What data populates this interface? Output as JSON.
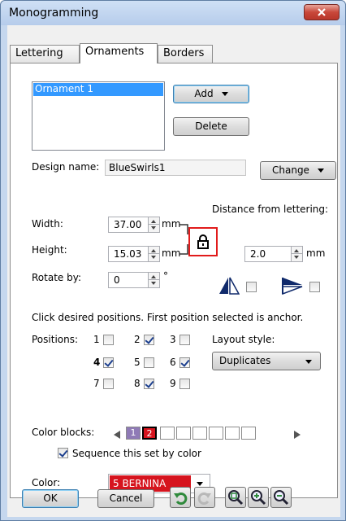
{
  "window": {
    "title": "Monogramming"
  },
  "tabs": [
    {
      "label": "Lettering",
      "active": false
    },
    {
      "label": "Ornaments",
      "active": true
    },
    {
      "label": "Borders",
      "active": false
    }
  ],
  "ornaments": {
    "list_items": [
      "Ornament 1"
    ],
    "add_label": "Add",
    "delete_label": "Delete",
    "design_name_label": "Design name:",
    "design_name_value": "BlueSwirls1",
    "change_label": "Change"
  },
  "size": {
    "distance_label": "Distance from lettering:",
    "width_label": "Width:",
    "width_value": "37.00",
    "height_label": "Height:",
    "height_value": "15.03",
    "unit_mm": "mm",
    "distance_value": "2.0",
    "rotate_label": "Rotate by:",
    "rotate_value": "0",
    "degree": "°"
  },
  "positions": {
    "instruction": "Click desired positions. First position selected is anchor.",
    "label": "Positions:",
    "items": [
      {
        "n": "1",
        "checked": false,
        "anchor": false
      },
      {
        "n": "2",
        "checked": true,
        "anchor": false
      },
      {
        "n": "3",
        "checked": false,
        "anchor": false
      },
      {
        "n": "4",
        "checked": true,
        "anchor": true
      },
      {
        "n": "5",
        "checked": false,
        "anchor": false
      },
      {
        "n": "6",
        "checked": true,
        "anchor": false
      },
      {
        "n": "7",
        "checked": false,
        "anchor": false
      },
      {
        "n": "8",
        "checked": true,
        "anchor": false
      },
      {
        "n": "9",
        "checked": false,
        "anchor": false
      }
    ],
    "layout_label": "Layout style:",
    "layout_value": "Duplicates"
  },
  "colors": {
    "blocks_label": "Color blocks:",
    "blocks": [
      {
        "label": "1",
        "color": "#8f7ab6"
      },
      {
        "label": "2",
        "color": "#d6141e"
      }
    ],
    "sequence_label": "Sequence this set by color",
    "sequence_checked": true,
    "color_label": "Color:",
    "color_value": "5 BERNINA",
    "color_swatch": "#d6141e"
  },
  "footer": {
    "ok_label": "OK",
    "cancel_label": "Cancel"
  },
  "theme": {
    "accent": "#3399ff",
    "highlight_red": "#e11b1b"
  }
}
